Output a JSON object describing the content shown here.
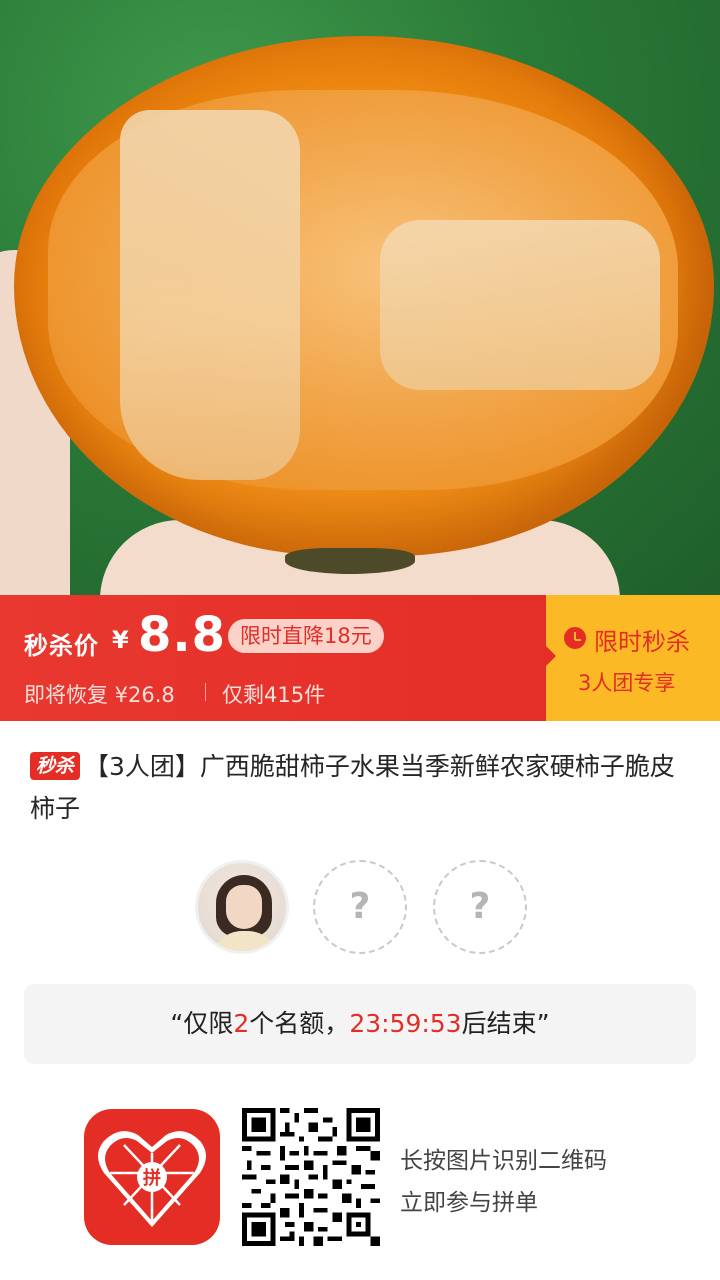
{
  "hero": {
    "image_alt": "persimmon-photo"
  },
  "price_bar": {
    "flash_label": "秒杀价",
    "currency": "¥",
    "price": "8.8",
    "drop_badge": "限时直降18元",
    "restore_text": "即将恢复 ¥26.8",
    "stock_text": "仅剩415件",
    "limited_title": "限时秒杀",
    "group_tag": "3人团专享",
    "colors": {
      "red": "#e42e28",
      "yellow": "#fbb925"
    }
  },
  "product": {
    "tag": "秒杀",
    "title": "【3人团】广西脆甜柿子水果当季新鲜农家硬柿子脆皮柿子"
  },
  "group": {
    "empty_slot_symbol": "?",
    "empty_slots": 2
  },
  "quota": {
    "open_quote": "“",
    "prefix": "仅限",
    "count": "2",
    "middle": "个名额，",
    "countdown": "23:59:53",
    "suffix": "后结束",
    "close_quote": "”"
  },
  "share": {
    "logo_icon": "pinduoduo-logo",
    "logo_text": "拼",
    "line1": "长按图片识别二维码",
    "line2": "立即参与拼单"
  }
}
